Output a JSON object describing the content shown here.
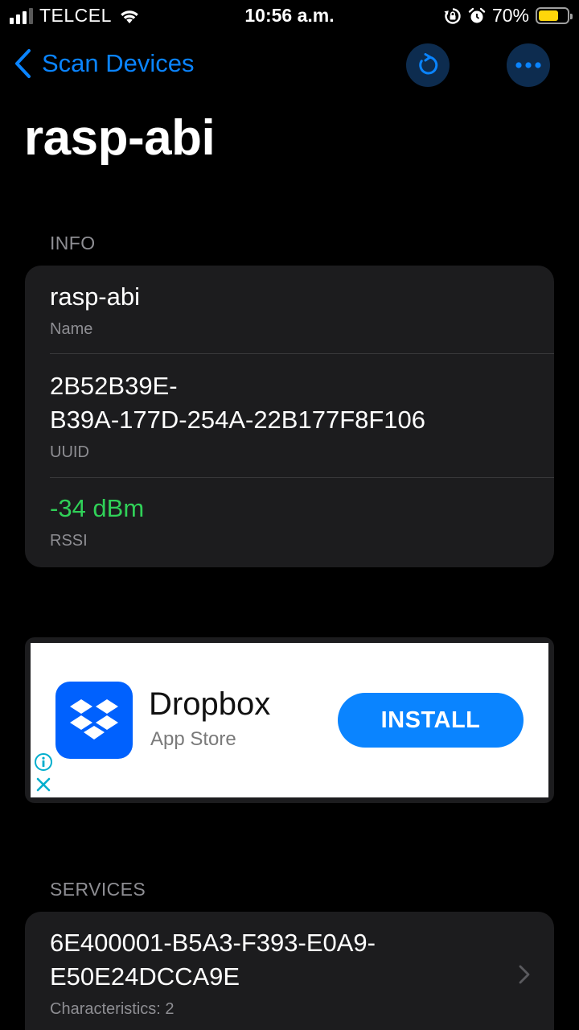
{
  "status_bar": {
    "carrier": "TELCEL",
    "time": "10:56 a.m.",
    "battery_percent_label": "70%",
    "battery_level": 0.7,
    "icons": [
      "signal-icon",
      "wifi-icon",
      "rotation-lock-icon",
      "alarm-icon",
      "battery-icon"
    ]
  },
  "nav": {
    "back_label": "Scan Devices",
    "refresh_icon": "refresh-icon",
    "more_icon": "more-icon"
  },
  "page_title": "rasp-abi",
  "info": {
    "header": "INFO",
    "name_value": "rasp-abi",
    "name_label": "Name",
    "uuid_value_line1": "2B52B39E-",
    "uuid_value_line2": "B39A-177D-254A-22B177F8F106",
    "uuid_label": "UUID",
    "rssi_value": "-34 dBm",
    "rssi_label": "RSSI"
  },
  "ad": {
    "app_name": "Dropbox",
    "store": "App Store",
    "install_label": "INSTALL",
    "icon": "dropbox-logo-icon"
  },
  "services": {
    "header": "SERVICES",
    "items": [
      {
        "uuid_line1": "6E400001-B5A3-F393-E0A9-",
        "uuid_line2": "E50E24DCCA9E",
        "characteristics": "Characteristics: 2"
      }
    ]
  },
  "colors": {
    "accent": "#0a84ff",
    "rssi_green": "#30d158",
    "card_bg": "#1c1c1e",
    "secondary_text": "#8e8e93",
    "dropbox_blue": "#0061fe"
  }
}
